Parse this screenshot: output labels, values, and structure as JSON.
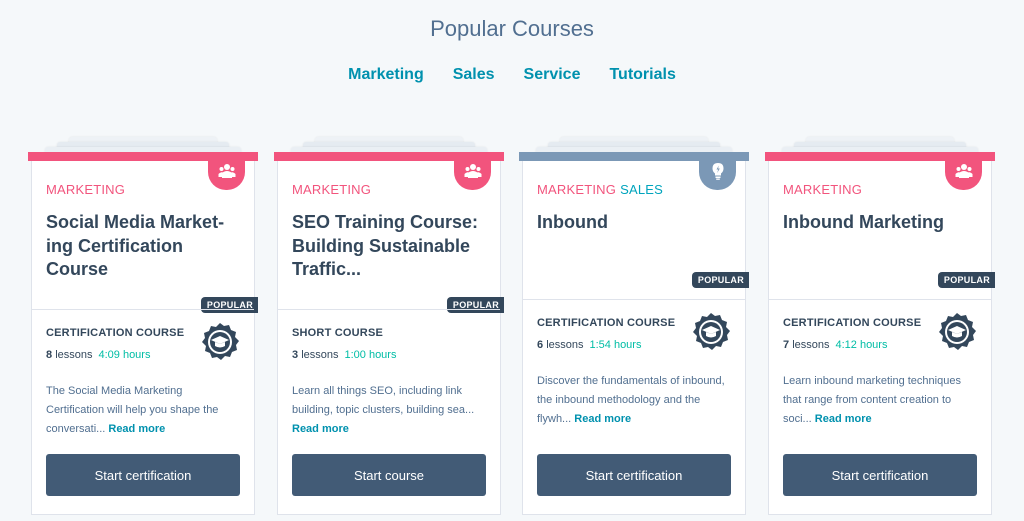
{
  "page_title": "Popular Courses",
  "tabs": [
    {
      "label": "Marketing"
    },
    {
      "label": "Sales"
    },
    {
      "label": "Service"
    },
    {
      "label": "Tutorials"
    }
  ],
  "colors": {
    "marketing_pink": "#f2547d",
    "sales_teal": "#00a4bd",
    "slate": "#7b98b6",
    "button": "#425b76",
    "hours_green": "#00bda5",
    "link_blue": "#0091ae"
  },
  "cards": [
    {
      "categories": [
        {
          "label": "MARKETING",
          "color": "#f2547d"
        }
      ],
      "bar_color": "#f2547d",
      "ribbon_icon": "people-icon",
      "title": "Social Media Market-ing Certification Course",
      "badge": "POPULAR",
      "course_type": "CERTIFICATION COURSE",
      "lessons_count": "8",
      "lessons_word": "lessons",
      "hours": "4:09 hours",
      "description": "The Social Media Marketing Certification will help you shape the conversati...",
      "read_more": "Read more",
      "button": "Start certification"
    },
    {
      "categories": [
        {
          "label": "MARKETING",
          "color": "#f2547d"
        }
      ],
      "bar_color": "#f2547d",
      "ribbon_icon": "people-icon",
      "title": "SEO Training Course: Building Sustainable Traffic...",
      "badge": "POPULAR",
      "course_type": "SHORT COURSE",
      "lessons_count": "3",
      "lessons_word": "lessons",
      "hours": "1:00 hours",
      "description": "Learn all things SEO, including link building, topic clusters, building sea...",
      "read_more": "Read more",
      "button": "Start course"
    },
    {
      "categories": [
        {
          "label": "MARKETING",
          "color": "#f2547d"
        },
        {
          "label": "SALES",
          "color": "#00a4bd"
        }
      ],
      "bar_color": "#7b98b6",
      "ribbon_icon": "lightbulb-icon",
      "title": "Inbound",
      "badge": "POPULAR",
      "course_type": "CERTIFICATION COURSE",
      "lessons_count": "6",
      "lessons_word": "lessons",
      "hours": "1:54 hours",
      "description": "Discover the fundamentals of inbound, the inbound methodology and the flywh...",
      "read_more": "Read more",
      "button": "Start certification"
    },
    {
      "categories": [
        {
          "label": "MARKETING",
          "color": "#f2547d"
        }
      ],
      "bar_color": "#f2547d",
      "ribbon_icon": "people-icon",
      "title": "Inbound Marketing",
      "badge": "POPULAR",
      "course_type": "CERTIFICATION COURSE",
      "lessons_count": "7",
      "lessons_word": "lessons",
      "hours": "4:12 hours",
      "description": "Learn inbound marketing techniques that range from content creation to soci...",
      "read_more": "Read more",
      "button": "Start certification"
    }
  ]
}
